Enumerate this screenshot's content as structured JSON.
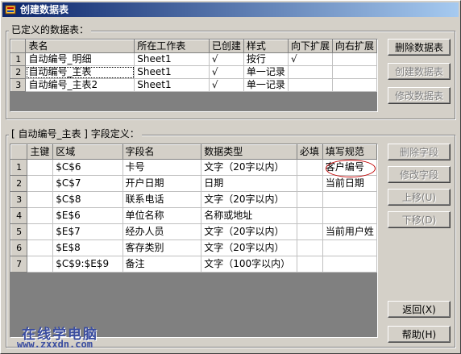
{
  "window": {
    "title": "创建数据表"
  },
  "top_group": {
    "label": "已定义的数据表：",
    "columns": [
      "表名",
      "所在工作表",
      "已创建",
      "样式",
      "向下扩展",
      "向右扩展"
    ],
    "rows": [
      {
        "num": "1",
        "name": "自动编号_明细",
        "sheet": "Sheet1",
        "created": "√",
        "style": "按行",
        "down": "√",
        "right": ""
      },
      {
        "num": "2",
        "name": "自动编号_主表",
        "sheet": "Sheet1",
        "created": "√",
        "style": "单一记录",
        "down": "",
        "right": ""
      },
      {
        "num": "3",
        "name": "自动编号_主表2",
        "sheet": "Sheet1",
        "created": "√",
        "style": "单一记录",
        "down": "",
        "right": ""
      }
    ],
    "buttons": {
      "delete_table": "删除数据表",
      "create_table": "创建数据表",
      "modify_table": "修改数据表"
    }
  },
  "field_group": {
    "label": "[ 自动编号_主表 ] 字段定义：",
    "columns": [
      "主键",
      "区域",
      "字段名",
      "数据类型",
      "必填",
      "填写规范"
    ],
    "rows": [
      {
        "num": "1",
        "pk": "",
        "range": "$C$6",
        "field": "卡号",
        "type": "文字（20字以内）",
        "req": "",
        "rule": "客户编号"
      },
      {
        "num": "2",
        "pk": "",
        "range": "$C$7",
        "field": "开户日期",
        "type": "日期",
        "req": "",
        "rule": "当前日期"
      },
      {
        "num": "3",
        "pk": "",
        "range": "$C$8",
        "field": "联系电话",
        "type": "文字（20字以内）",
        "req": "",
        "rule": ""
      },
      {
        "num": "4",
        "pk": "",
        "range": "$E$6",
        "field": "单位名称",
        "type": "名称或地址",
        "req": "",
        "rule": ""
      },
      {
        "num": "5",
        "pk": "",
        "range": "$E$7",
        "field": "经办人员",
        "type": "文字（20字以内）",
        "req": "",
        "rule": "当前用户姓"
      },
      {
        "num": "6",
        "pk": "",
        "range": "$E$8",
        "field": "客存类别",
        "type": "文字（20字以内）",
        "req": "",
        "rule": ""
      },
      {
        "num": "7",
        "pk": "",
        "range": "$C$9:$E$9",
        "field": "备注",
        "type": "文字（100字以内）",
        "req": "",
        "rule": ""
      }
    ],
    "buttons": {
      "delete_field": "删除字段",
      "modify_field": "修改字段",
      "move_up": "上移(U)",
      "move_down": "下移(D)"
    }
  },
  "footer_buttons": {
    "back": "返回(X)",
    "help": "帮助(H)"
  },
  "watermark": {
    "line1": "在线学电脑",
    "line2": "www.zxxdn.com"
  }
}
